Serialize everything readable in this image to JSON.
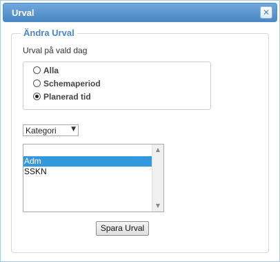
{
  "dialog": {
    "title": "Urval",
    "close_icon": "close-icon"
  },
  "fieldset": {
    "legend": "Ändra Urval",
    "subtitle": "Urval på vald dag",
    "radios": [
      {
        "label": "Alla",
        "checked": false
      },
      {
        "label": "Schemaperiod",
        "checked": false
      },
      {
        "label": "Planerad tid",
        "checked": true
      }
    ],
    "category_select": {
      "selected": "Kategori"
    },
    "list_items": [
      {
        "label": "Adm",
        "selected": true
      },
      {
        "label": "SSKN",
        "selected": false
      }
    ],
    "save_button": "Spara Urval"
  },
  "colors": {
    "titlebar": "#4a87c4",
    "legend": "#4a86c6",
    "selection": "#3399dd"
  }
}
